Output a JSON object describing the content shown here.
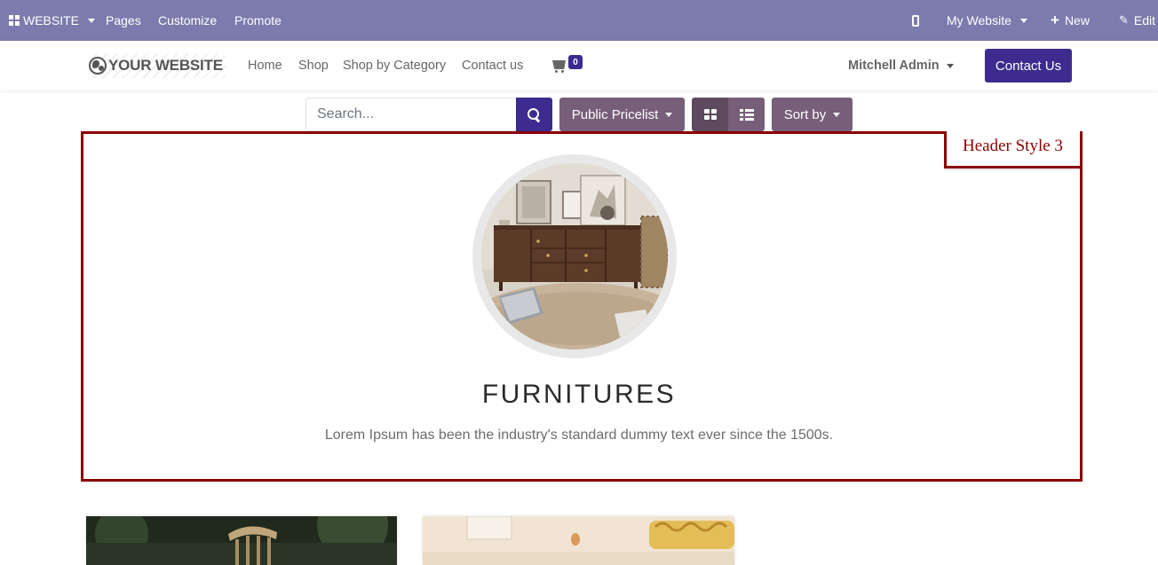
{
  "adminbar": {
    "app_label": "WEBSITE",
    "menu": [
      "Pages",
      "Customize",
      "Promote"
    ],
    "site_label": "My Website",
    "new_label": "New",
    "edit_label": "Edit"
  },
  "navbar": {
    "logo_text": "YOUR WEBSITE",
    "links": [
      "Home",
      "Shop",
      "Shop by Category",
      "Contact us"
    ],
    "cart_count": "0",
    "user_name": "Mitchell Admin",
    "contact_label": "Contact Us"
  },
  "toolbar": {
    "search_placeholder": "Search...",
    "pricelist_label": "Public Pricelist",
    "sort_label": "Sort by"
  },
  "header_section": {
    "tag": "Header Style 3",
    "title": "FURNITURES",
    "description": "Lorem Ipsum has been the industry's standard dummy text ever since the 1500s."
  },
  "colors": {
    "admin_bar": "#7c7bad",
    "primary": "#3d2b8f",
    "secondary": "#775e79",
    "highlight_border": "#8b0000"
  }
}
